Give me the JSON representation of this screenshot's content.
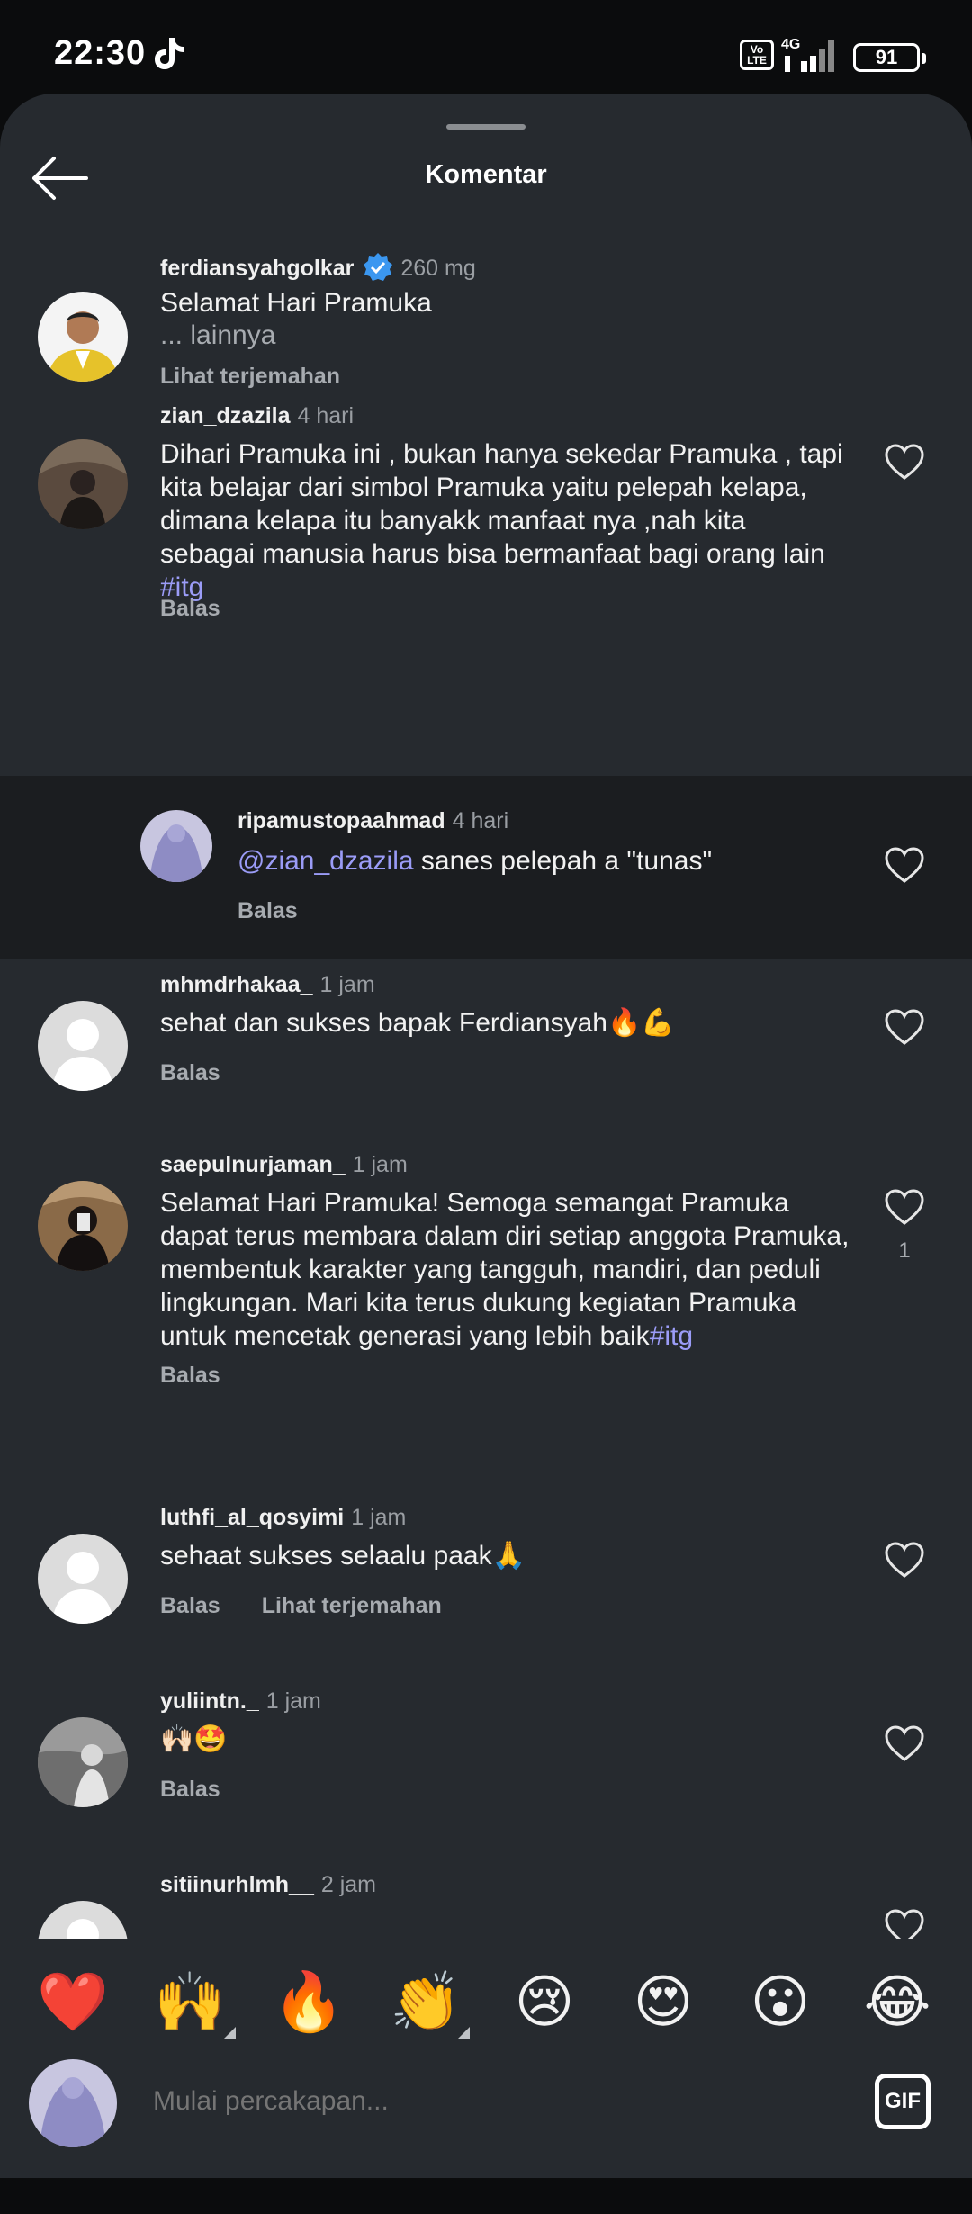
{
  "status_bar": {
    "time": "22:30",
    "network": "4G",
    "volte": "Vo LTE",
    "battery": "91"
  },
  "header": {
    "title": "Komentar"
  },
  "caption": {
    "username": "ferdiansyahgolkar",
    "time": "260 mg",
    "text": "Selamat Hari Pramuka",
    "more": "... lainnya",
    "translate": "Lihat terjemahan"
  },
  "comments": [
    {
      "username": "zian_dzazila",
      "time": "4 hari",
      "text": "Dihari Pramuka ini , bukan hanya sekedar Pramuka , tapi kita belajar dari simbol Pramuka yaitu pelepah kelapa, dimana kelapa itu banyakk manfaat nya ,nah kita sebagai manusia harus bisa bermanfaat bagi orang lain ",
      "hashtag": "#itg",
      "reply": "Balas"
    },
    {
      "username": "ripamustopaahmad",
      "time": "4 hari",
      "mention": "@zian_dzazila",
      "text": " sanes pelepah a \"tunas\"",
      "reply": "Balas"
    },
    {
      "username": "mhmdrhakaa_",
      "time": "1 jam",
      "text": "sehat dan sukses bapak Ferdiansyah🔥💪",
      "reply": "Balas"
    },
    {
      "username": "saepulnurjaman_",
      "time": "1 jam",
      "text": "Selamat Hari Pramuka! Semoga semangat Pramuka dapat terus membara dalam diri setiap anggota Pramuka, membentuk karakter yang tangguh, mandiri, dan peduli lingkungan. Mari kita terus dukung kegiatan Pramuka untuk mencetak generasi yang lebih baik",
      "hashtag": "#itg",
      "likes": "1",
      "reply": "Balas"
    },
    {
      "username": "luthfi_al_qosyimi",
      "time": "1 jam",
      "text": "sehaat sukses selaalu paak🙏",
      "reply": "Balas",
      "translate": "Lihat terjemahan"
    },
    {
      "username": "yuliintn._",
      "time": "1 jam",
      "text": "🙌🏻🤩",
      "reply": "Balas"
    },
    {
      "username": "sitiinurhlmh__",
      "time": "2 jam"
    }
  ],
  "emoji_bar": [
    "❤️",
    "🙌",
    "🔥",
    "👏",
    "😢",
    "😍",
    "😮",
    "😂"
  ],
  "composer": {
    "placeholder": "Mulai percakapan...",
    "gif_label": "GIF"
  },
  "colors": {
    "background": "#262a2f",
    "reply_background": "#1b1d20",
    "hashtag": "#9b9cf7",
    "verified": "#3b97f0"
  }
}
